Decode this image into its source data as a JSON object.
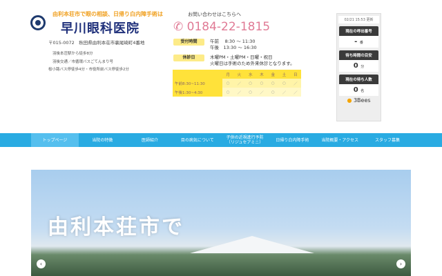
{
  "header": {
    "tagline": "由利本荘市で眼の相談、日帰り白内障手術は",
    "clinic_name": "早川眼科医院",
    "address": "〒015-0072　秋田県由利本荘市裏尾崎町4番地",
    "access": [
      "羽後本荘駅から徒歩8分",
      "羽後交通／市循環バスごてんまり号",
      "桜小路バス停徒歩4分・市役所前バス停徒歩2分"
    ]
  },
  "contact": {
    "label": "お問い合わせはこちらへ",
    "phone": "0184-22-1815",
    "hours_label": "受付時間",
    "hours": [
      "午前　 8:30 ～ 11:30",
      "午後　13:30 ～ 16:30"
    ],
    "closed_label": "休診日",
    "closed": [
      "木曜PM・土曜PM・日曜・祝日",
      "火曜日は手術のため外来休診となります。"
    ]
  },
  "schedule": {
    "days": [
      "月",
      "火",
      "水",
      "木",
      "金",
      "土",
      "日"
    ],
    "rows": [
      {
        "label": "午前8:30~11:30",
        "marks": [
          "○",
          "／",
          "○",
          "○",
          "○",
          "○",
          "／"
        ]
      },
      {
        "label": "午後1:30~4:30",
        "marks": [
          "○",
          "／",
          "○",
          "／",
          "○",
          "／",
          "／"
        ]
      }
    ]
  },
  "status": {
    "updated": "02/21 15:53 更新",
    "boxes": [
      {
        "title": "現在の呼出番号",
        "value": "-",
        "unit": "番"
      },
      {
        "title": "待ち時間の目安",
        "value": "0",
        "unit": "分"
      },
      {
        "title": "現在の待ち人数",
        "value": "0",
        "unit": "名"
      }
    ],
    "brand": "3Bees"
  },
  "nav": [
    "トップページ",
    "当院の特徴",
    "医師紹介",
    "目の病気について",
    "子供の近視進行予防\n（リジュセアミニ）",
    "日帰り白内障手術",
    "当院概要・アクセス",
    "スタッフ募集"
  ],
  "banner": {
    "text": "由利本荘市で"
  }
}
